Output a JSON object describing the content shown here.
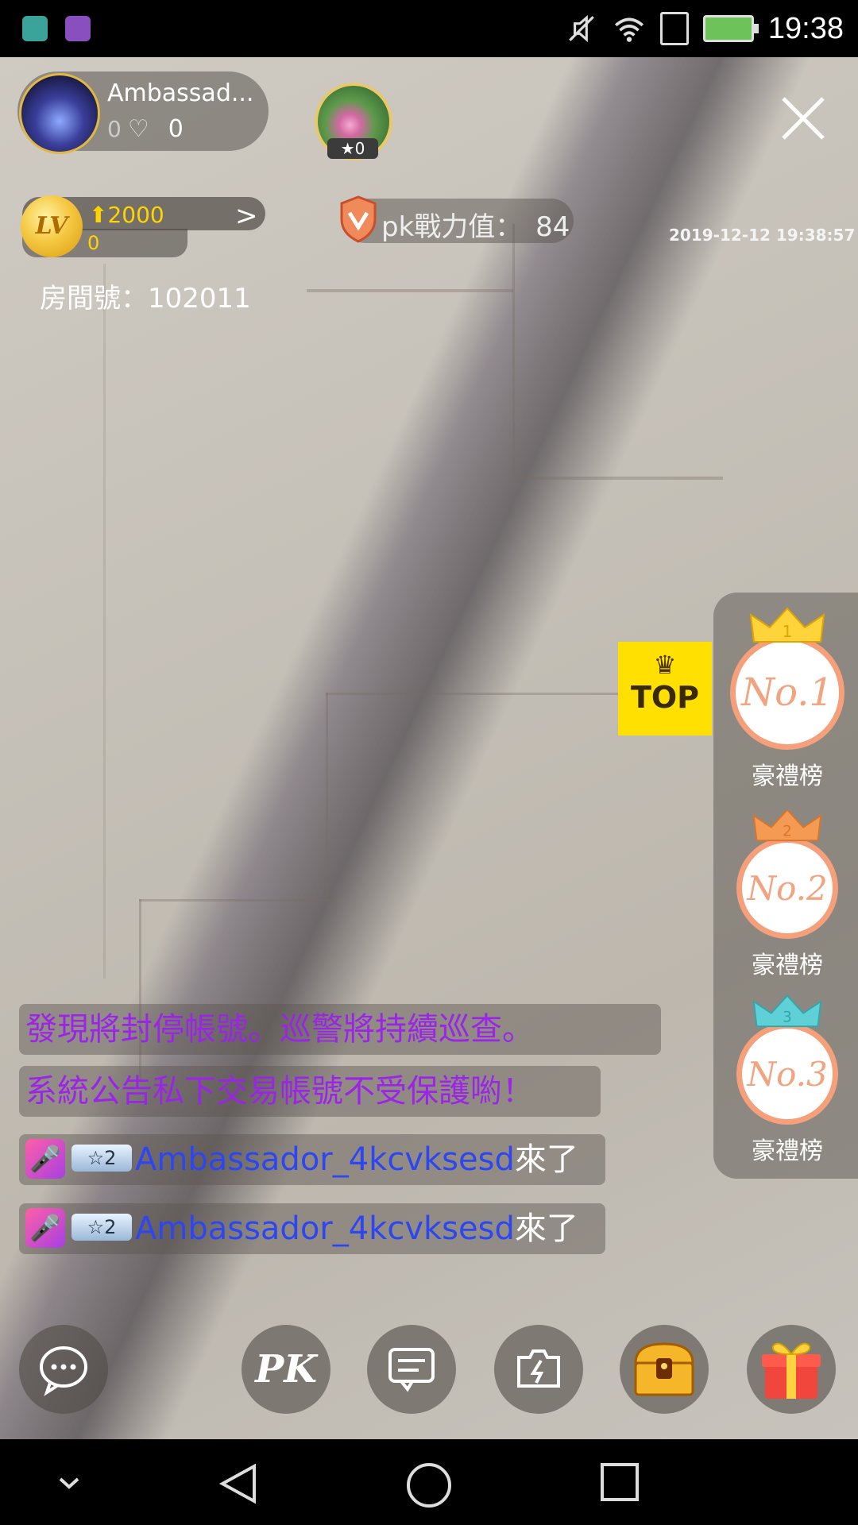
{
  "status_bar": {
    "time": "19:38",
    "icons": [
      "android-icon",
      "gallery-icon",
      "mute-icon",
      "wifi-icon",
      "sim-icon",
      "battery-charging-icon"
    ]
  },
  "host": {
    "name": "Ambassad...",
    "likes_small": "0",
    "likes": "0"
  },
  "guest": {
    "stars": "0"
  },
  "level": {
    "coin_label": "LV",
    "upgrade_value": "2000",
    "current_value": "0"
  },
  "pk": {
    "label": "pk戰力值：",
    "value": "84"
  },
  "timestamp": "2019-12-12 19:38:57",
  "room": {
    "label": "房間號：",
    "number": "102011"
  },
  "top_button": {
    "label": "TOP"
  },
  "rankings": [
    {
      "badge": "No.1",
      "crown_number": "1",
      "label": "豪禮榜",
      "color": "#f5a07a",
      "crown_color": "#ffd43b"
    },
    {
      "badge": "No.2",
      "crown_number": "2",
      "label": "豪禮榜",
      "color": "#f5a07a",
      "crown_color": "#f59a52"
    },
    {
      "badge": "No.3",
      "crown_number": "3",
      "label": "豪禮榜",
      "color": "#f5a07a",
      "crown_color": "#5fd0d6"
    }
  ],
  "chat": {
    "system_messages": [
      "發現將封停帳號。巡警將持續巡查。",
      "系統公告私下交易帳號不受保護喲！"
    ],
    "join_messages": [
      {
        "level": "2",
        "user": "Ambassador_4kcvksesd",
        "suffix": "來了"
      },
      {
        "level": "2",
        "user": "Ambassador_4kcvksesd",
        "suffix": "來了"
      }
    ]
  },
  "bottom_bar": {
    "buttons": [
      "chat-bubble-icon",
      "pk-icon",
      "message-icon",
      "flip-camera-icon",
      "treasure-chest-icon",
      "gift-icon"
    ],
    "pk_label": "PK"
  },
  "nav_bar": {
    "icons": [
      "collapse-icon",
      "back-icon",
      "home-icon",
      "recents-icon"
    ]
  },
  "colors": {
    "system_text": "#9b24e8",
    "user_name": "#2e46f0",
    "rank_accent": "#f5a07a",
    "top_yellow": "#ffe000",
    "level_yellow": "#ffd400"
  }
}
